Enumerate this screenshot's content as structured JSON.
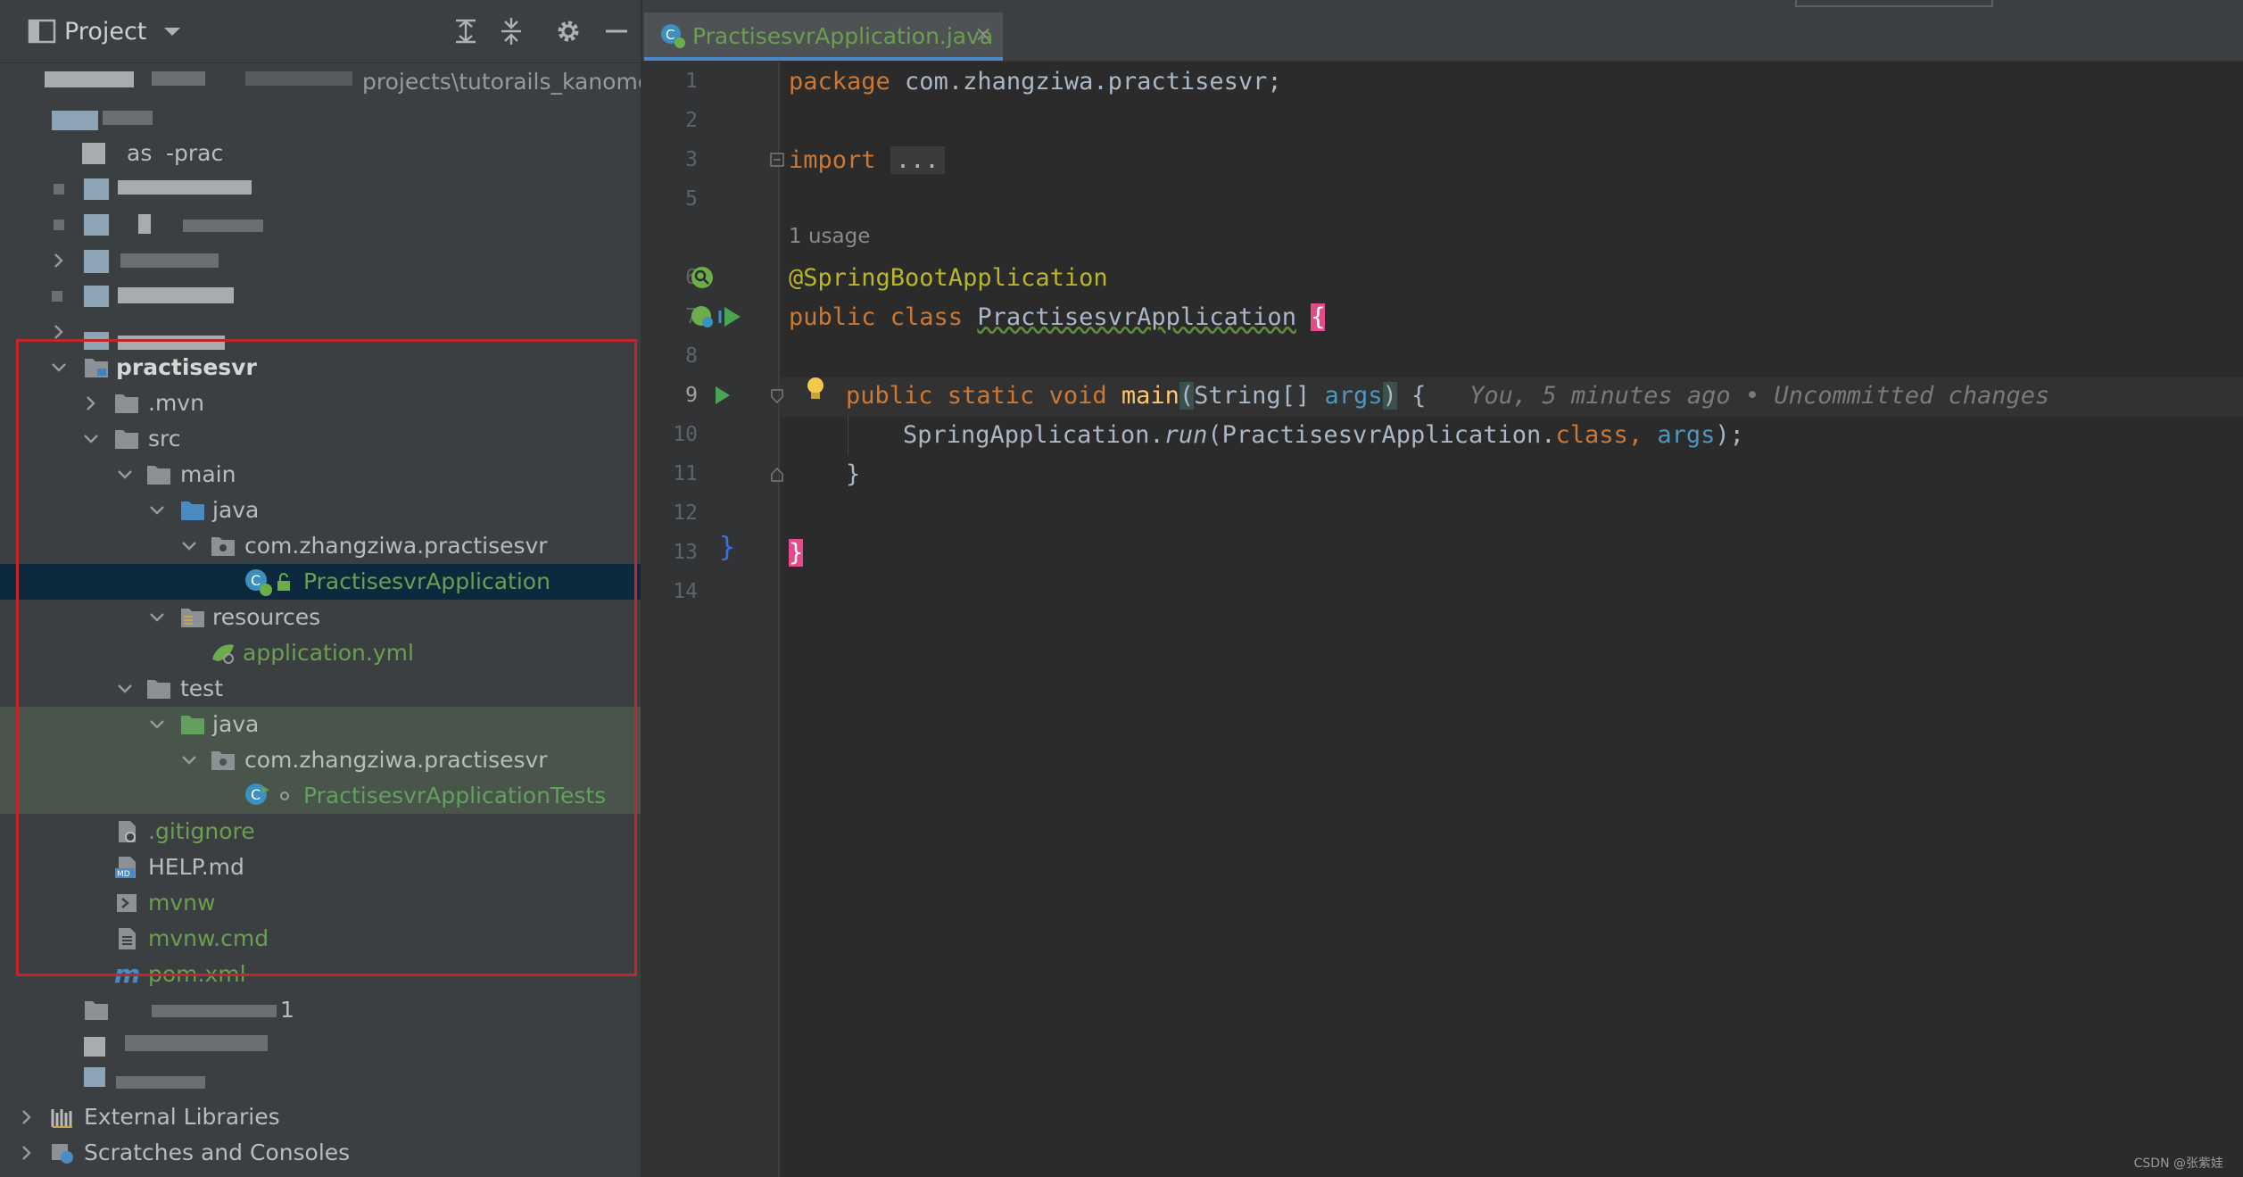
{
  "project_panel": {
    "title": "Project",
    "root_path_text": "projects\\tutorails_kanomok",
    "blurred_rows": {
      "prac": "-prac",
      "as": "as",
      "one": "1"
    },
    "tree": {
      "practisesvr": "practisesvr",
      "mvn": ".mvn",
      "src": "src",
      "main": "main",
      "java": "java",
      "package": "com.zhangziwa.practisesvr",
      "app_class": "PractisesvrApplication",
      "resources": "resources",
      "application_yml": "application.yml",
      "test": "test",
      "test_java": "java",
      "test_package": "com.zhangziwa.practisesvr",
      "test_class": "PractisesvrApplicationTests",
      "gitignore": ".gitignore",
      "help_md": "HELP.md",
      "mvnw": "mvnw",
      "mvnw_cmd": "mvnw.cmd",
      "pom_xml": "pom.xml",
      "external_libraries": "External Libraries",
      "scratches": "Scratches and Consoles"
    },
    "md_badge": "MD",
    "maven_badge": "m"
  },
  "editor": {
    "tab_title": "PractisesvrApplication.java",
    "tab_close": "×",
    "line_numbers": [
      "1",
      "2",
      "3",
      "5",
      "6",
      "7",
      "8",
      "9",
      "10",
      "11",
      "12",
      "13",
      "14"
    ],
    "usage_hint": "1 usage",
    "code": {
      "l1_kw": "package",
      "l1_pkg": " com.zhangziwa.practisesvr;",
      "l3_kw": "import",
      "l3_fold": "...",
      "l6_ann": "@SpringBootApplication",
      "l7_kw": "public class ",
      "l7_name": "PractisesvrApplication",
      "l7_brace": "{",
      "l9_kw": "public static void ",
      "l9_fn": "main",
      "l9_paren_open": "(",
      "l9_type": "String[] ",
      "l9_param": "args",
      "l9_paren_close": ")",
      "l9_brace": " {",
      "l9_hint": "You, 5 minutes ago • Uncommitted changes",
      "l10_a": "SpringApplication.",
      "l10_run": "run",
      "l10_b": "(PractisesvrApplication.",
      "l10_class": "class",
      "l10_c": ", ",
      "l10_args": "args",
      "l10_d": ");",
      "l11_brace": "}",
      "l13_brace": "}"
    }
  },
  "watermark": "CSDN @张紫娃",
  "colors": {
    "keyword": "#cc7832",
    "annotation": "#bbb529",
    "function": "#ffc66d",
    "parameter": "#4a98c1",
    "highlight_brace": "#e54a8a",
    "frame": "#c2262b"
  }
}
